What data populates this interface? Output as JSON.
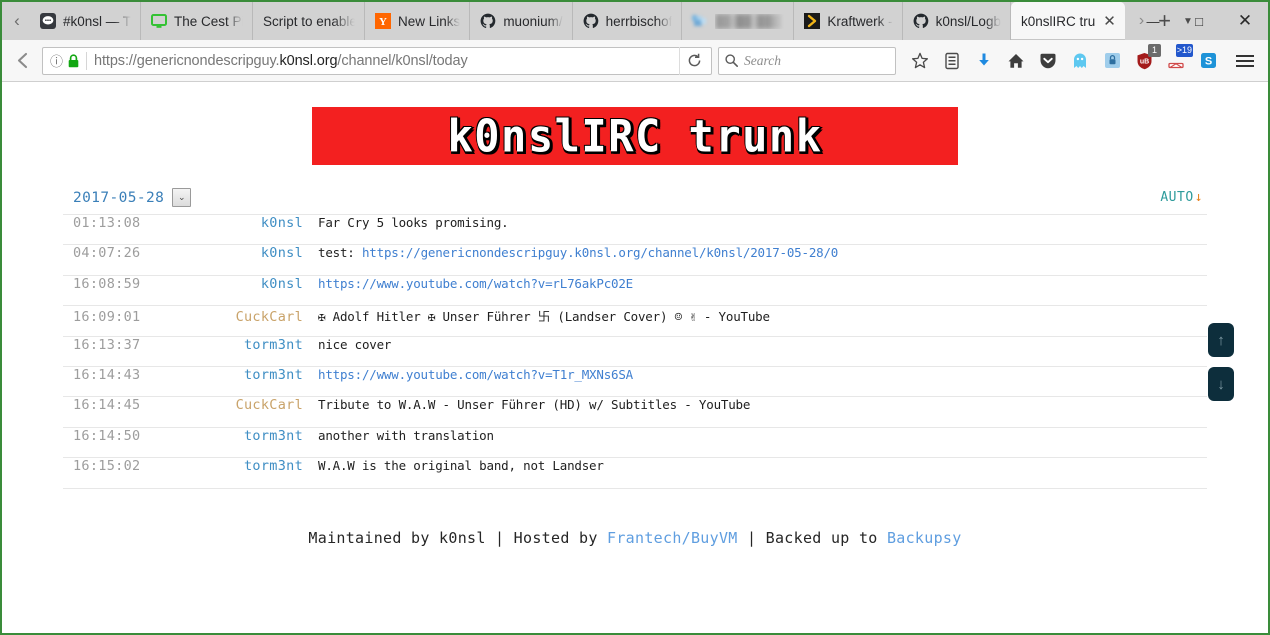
{
  "browser": {
    "tabs": [
      {
        "title": "#k0nsl — T",
        "icon": "chat-bubble-icon",
        "active": false,
        "blurred": false
      },
      {
        "title": "The Cest Pi",
        "icon": "monitor-icon",
        "active": false,
        "blurred": false
      },
      {
        "title": "Script to enable",
        "icon": "none",
        "active": false,
        "blurred": false
      },
      {
        "title": "New Links",
        "icon": "hacker-news-icon",
        "active": false,
        "blurred": false
      },
      {
        "title": "muonium/",
        "icon": "github-icon",
        "active": false,
        "blurred": false
      },
      {
        "title": "herrbischof",
        "icon": "github-icon",
        "active": false,
        "blurred": false
      },
      {
        "title": "blurred tab",
        "icon": "blurred-icon",
        "active": false,
        "blurred": true
      },
      {
        "title": "Kraftwerk -",
        "icon": "kraftwerk-icon",
        "active": false,
        "blurred": false
      },
      {
        "title": "k0nsl/Logb",
        "icon": "github-icon",
        "active": false,
        "blurred": false
      },
      {
        "title": "k0nslIRC tru",
        "icon": "none",
        "active": true,
        "blurred": false
      }
    ],
    "tab_close_label": "✕",
    "tab_list_arrow": "›",
    "new_tab_label": "+",
    "tab_dropdown_label": "▼",
    "window_controls": {
      "minimize": "—",
      "maximize": "□",
      "close": "✕"
    },
    "back_label": "←",
    "identity_label": "ⓘ",
    "url": {
      "prefix": "https://genericnondescripguy.",
      "host_bold": "k0nsl.org",
      "path": "/channel/k0nsl/today"
    },
    "reload_label": "⟳",
    "search": {
      "placeholder": "Search",
      "value": ""
    },
    "toolbar_icons": [
      {
        "name": "bookmark-star-icon",
        "glyph": "☆",
        "badge": null,
        "color": "#4a4a4a"
      },
      {
        "name": "reader-list-icon",
        "glyph": "☷",
        "badge": null,
        "color": "#4a4a4a"
      },
      {
        "name": "downloads-icon",
        "glyph": "⬇",
        "badge": null,
        "color": "#1f8ae0"
      },
      {
        "name": "home-icon",
        "glyph": "⌂",
        "badge": null,
        "color": "#3d3d3d"
      },
      {
        "name": "pocket-icon",
        "glyph": "▼",
        "badge": null,
        "color": "#3d3d3d"
      },
      {
        "name": "ghostery-icon",
        "glyph": "●",
        "badge": null,
        "color": "#5ec8f0"
      },
      {
        "name": "lastpass-icon",
        "glyph": "■",
        "badge": null,
        "color": "#6fb8e8"
      },
      {
        "name": "ublock-origin-icon",
        "glyph": "◆",
        "badge": "1",
        "badge_color": "#6b6b6b",
        "color": "#a41b1b"
      },
      {
        "name": "mail-notifier-icon",
        "glyph": "✉",
        "badge": ">19",
        "badge_color": "#2257cc",
        "color": "#2257cc"
      },
      {
        "name": "skype-icon",
        "glyph": "S",
        "badge": null,
        "color": "#1e93d8"
      }
    ],
    "menu_label": "menu-icon"
  },
  "page": {
    "banner_title": "k0nslIRC trunk",
    "banner_bg": "#f32020",
    "date_selected": "2017-05-28",
    "date_dropdown_glyph": "⌄",
    "auto_label": "AUTO",
    "auto_arrow_glyph": "↓",
    "scroll_top_glyph": "↑",
    "scroll_bottom_glyph": "↓",
    "messages": [
      {
        "time": "01:13:08",
        "nick": "k0nsl",
        "nick_color": "blue",
        "text": "Far Cry 5 looks promising.",
        "link": null
      },
      {
        "time": "04:07:26",
        "nick": "k0nsl",
        "nick_color": "blue",
        "text": "test: ",
        "link": "https://genericnondescripguy.k0nsl.org/channel/k0nsl/2017-05-28/0"
      },
      {
        "time": "16:08:59",
        "nick": "k0nsl",
        "nick_color": "blue",
        "text": "",
        "link": "https://www.youtube.com/watch?v=rL76akPc02E"
      },
      {
        "time": "16:09:01",
        "nick": "CuckCarl",
        "nick_color": "tan",
        "text": "✠ Adolf Hitler ✠ Unser Führer 卐 (Landser Cover) ☺ ✌  - YouTube",
        "link": null
      },
      {
        "time": "16:13:37",
        "nick": "torm3nt",
        "nick_color": "blue",
        "text": "nice cover",
        "link": null
      },
      {
        "time": "16:14:43",
        "nick": "torm3nt",
        "nick_color": "blue",
        "text": "",
        "link": "https://www.youtube.com/watch?v=T1r_MXNs6SA"
      },
      {
        "time": "16:14:45",
        "nick": "CuckCarl",
        "nick_color": "tan",
        "text": "Tribute to W.A.W - Unser Führer (HD) w/ Subtitles - YouTube",
        "link": null
      },
      {
        "time": "16:14:50",
        "nick": "torm3nt",
        "nick_color": "blue",
        "text": "another with translation",
        "link": null
      },
      {
        "time": "16:15:02",
        "nick": "torm3nt",
        "nick_color": "blue",
        "text": "W.A.W is the original band, not Landser",
        "link": null
      }
    ],
    "footer": {
      "part1": "Maintained by k0nsl  |  Hosted by ",
      "link1": "Frantech/BuyVM",
      "part2": "  |  Backed up to ",
      "link2": "Backupsy"
    }
  }
}
